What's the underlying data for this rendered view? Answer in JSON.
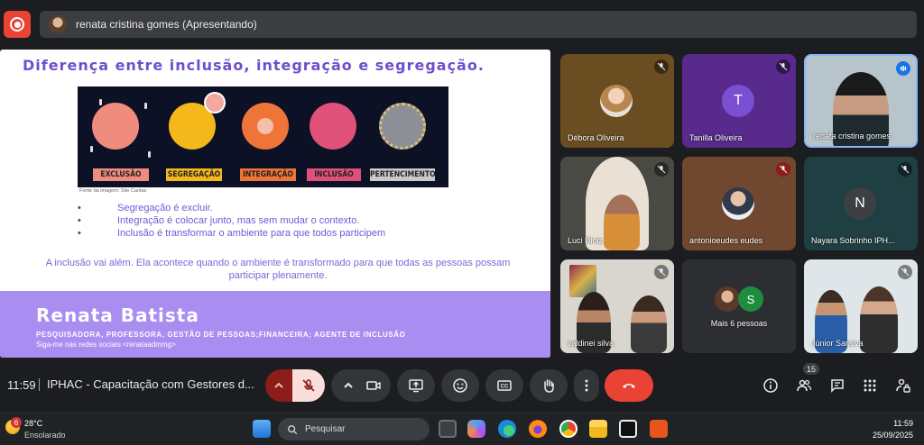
{
  "presenting": {
    "label": "renata cristina gomes (Apresentando)"
  },
  "slide": {
    "title": "Diferença entre inclusão, integração e segregação.",
    "infographic_labels": [
      "EXCLUSÃO",
      "SEGREGAÇÃO",
      "INTEGRAÇÃO",
      "INCLUSÃO",
      "PERTENCIMENTO"
    ],
    "source": "Fonte da imagem: Site Caritas",
    "bullets": [
      "Segregação é excluir.",
      "Integração é colocar junto, mas sem mudar o contexto.",
      "Inclusão é transformar o ambiente para que todos participem"
    ],
    "paragraph": "A inclusão vai além. Ela acontece quando o ambiente é transformado para que todas as pessoas possam participar plenamente.",
    "footer_name": "Renata Batista",
    "footer_role": "PESQUISADORA, PROFESSORA, GESTÃO DE PESSOAS;FINANCEIRA; AGENTE DE INCLUSÃO",
    "footer_social": "Siga-me nas redes sociais <renataadmmg>"
  },
  "participants": [
    {
      "name": "Débora Oliveira"
    },
    {
      "name": "Tanilla Oliveira",
      "initial": "T"
    },
    {
      "name": "renata cristina gomes"
    },
    {
      "name": "Luci Diniz"
    },
    {
      "name": "antonioeudes eudes"
    },
    {
      "name": "Nayara Sobrinho IPH...",
      "initial": "N"
    },
    {
      "name": "valdinei silva"
    },
    {
      "name": "Mais 6 pessoas",
      "initial": "S"
    },
    {
      "name": "Júnior Saraiva"
    }
  ],
  "meeting": {
    "time": "11:59",
    "title": "IPHAC - Capacitação com Gestores d...",
    "people_count": "15"
  },
  "taskbar": {
    "temperature": "28°C",
    "condition": "Ensolarado",
    "weather_badge": "6",
    "search_placeholder": "Pesquisar",
    "clock_time": "11:59",
    "clock_date": "25/09/2025"
  },
  "colors": {
    "accent_purple": "#6e4fcf",
    "footer_purple": "#a98df0",
    "end_call_red": "#ea4335"
  }
}
